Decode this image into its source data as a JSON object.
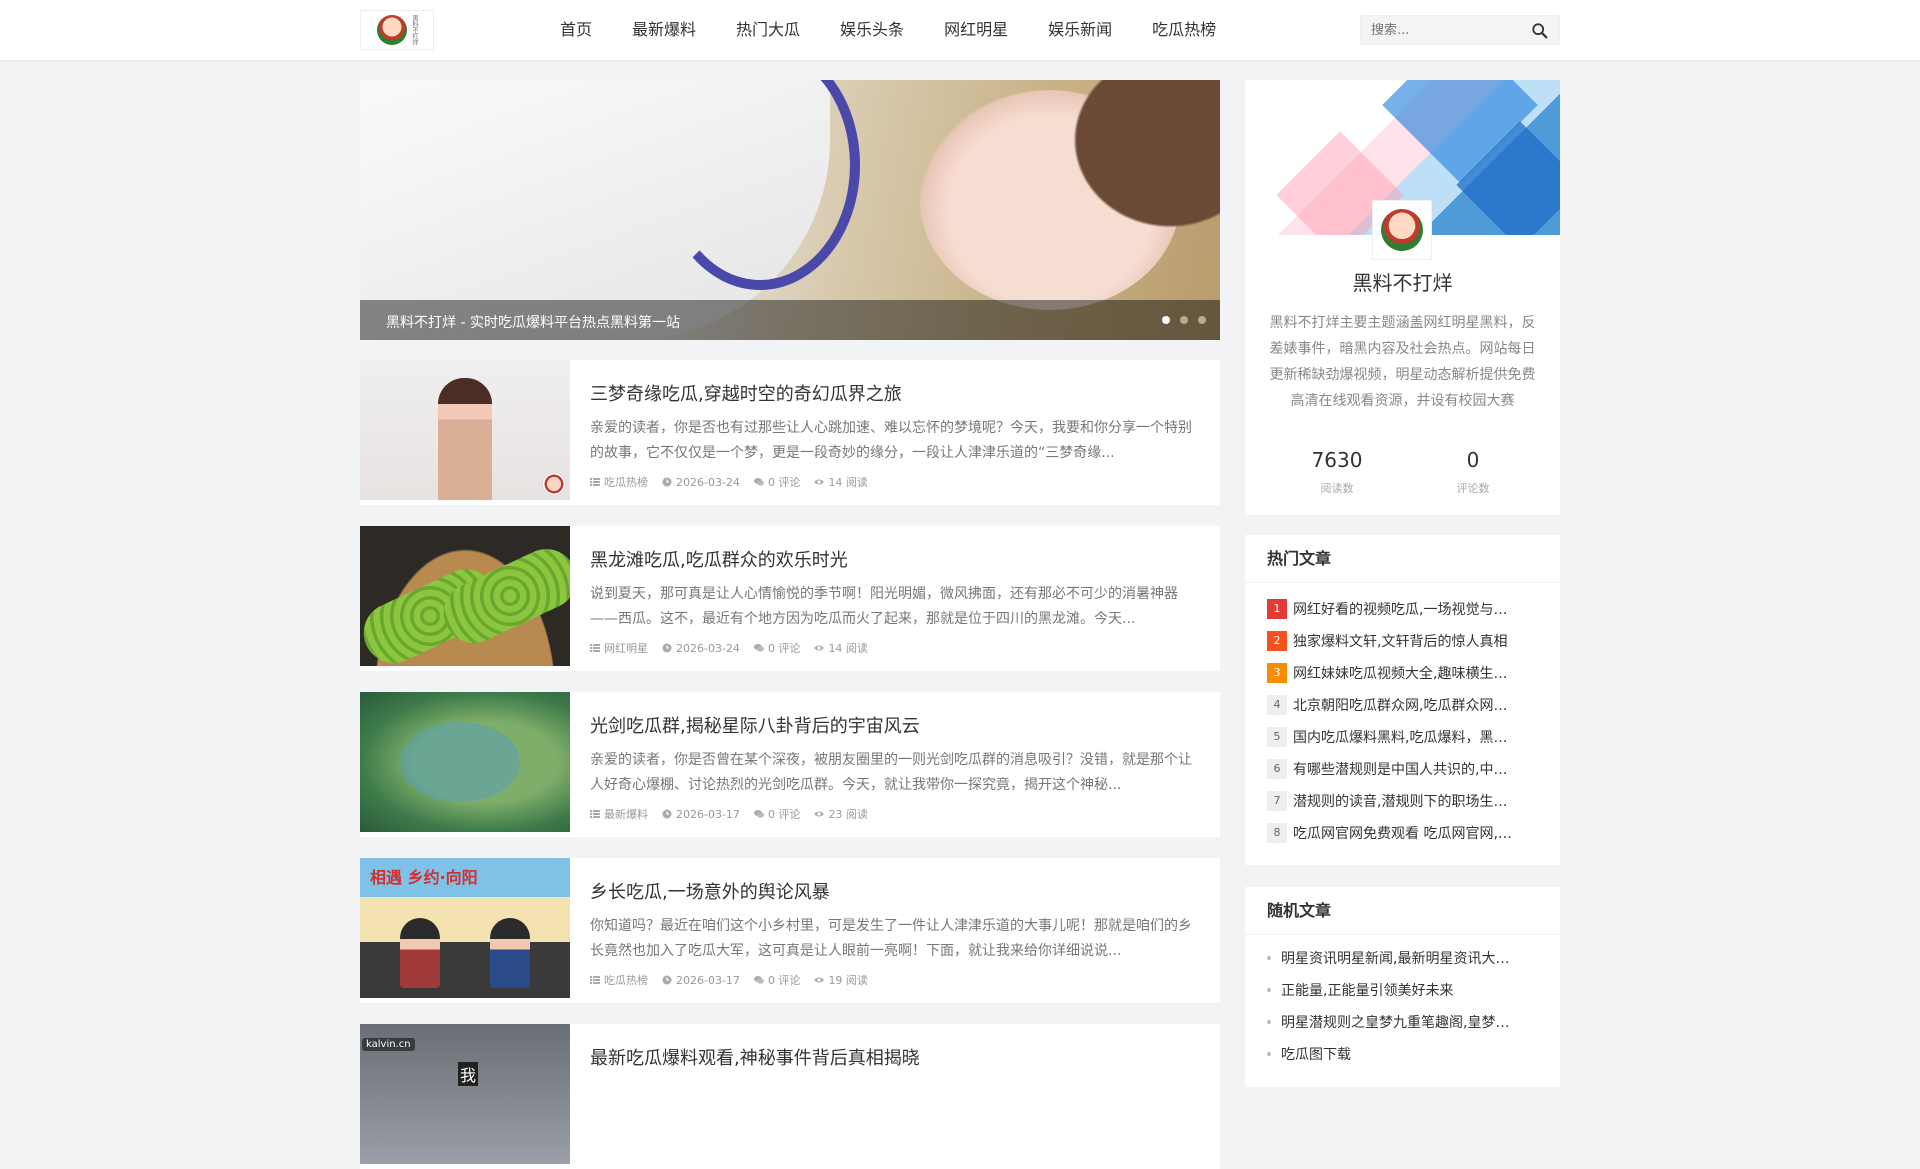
{
  "site": {
    "logo_text": "黑料不打烊"
  },
  "nav": {
    "items": [
      "首页",
      "最新爆料",
      "热门大瓜",
      "娱乐头条",
      "网红明星",
      "娱乐新闻",
      "吃瓜热榜"
    ]
  },
  "search": {
    "placeholder": "搜索..."
  },
  "slider": {
    "caption": "黑料不打烊 - 实时吃瓜爆料平台热点黑料第一站",
    "slide_count": 3,
    "active_index": 0
  },
  "articles": [
    {
      "title": "三梦奇缘吃瓜,穿越时空的奇幻瓜界之旅",
      "excerpt": "亲爱的读者，你是否也有过那些让人心跳加速、难以忘怀的梦境呢？今天，我要和你分享一个特别的故事，它不仅仅是一个梦，更是一段奇妙的缘分，一段让人津津乐道的“三梦奇缘...",
      "category": "吃瓜热榜",
      "date": "2026-03-24",
      "comments": "0 评论",
      "views": "14 阅读"
    },
    {
      "title": "黑龙滩吃瓜,吃瓜群众的欢乐时光",
      "excerpt": "说到夏天，那可真是让人心情愉悦的季节啊！阳光明媚，微风拂面，还有那必不可少的消暑神器——西瓜。这不，最近有个地方因为吃瓜而火了起来，那就是位于四川的黑龙滩。今天...",
      "category": "网红明星",
      "date": "2026-03-24",
      "comments": "0 评论",
      "views": "14 阅读"
    },
    {
      "title": "光剑吃瓜群,揭秘星际八卦背后的宇宙风云",
      "excerpt": "亲爱的读者，你是否曾在某个深夜，被朋友圈里的一则光剑吃瓜群的消息吸引？没错，就是那个让人好奇心爆棚、讨论热烈的光剑吃瓜群。今天，就让我带你一探究竟，揭开这个神秘...",
      "category": "最新爆料",
      "date": "2026-03-17",
      "comments": "0 评论",
      "views": "23 阅读"
    },
    {
      "title": "乡长吃瓜,一场意外的舆论风暴",
      "excerpt": "你知道吗？最近在咱们这个小乡村里，可是发生了一件让人津津乐道的大事儿呢！那就是咱们的乡长竟然也加入了吃瓜大军，这可真是让人眼前一亮啊！下面，就让我来给你详细说说...",
      "category": "吃瓜热榜",
      "date": "2026-03-17",
      "comments": "0 评论",
      "views": "19 阅读",
      "thumb_text": "相遇 乡约·向阳"
    },
    {
      "title": "最新吃瓜爆料观看,神秘事件背后真相揭晓",
      "excerpt": "",
      "category": "",
      "date": "",
      "comments": "",
      "views": "",
      "thumb_watermark": "kalvin.cn",
      "thumb_char": "我"
    }
  ],
  "profile": {
    "name": "黑料不打烊",
    "description": "黑料不打烊主要主题涵盖网红明星黑料，反差婊事件，暗黑内容及社会热点。网站每日更新稀缺劲爆视频，明星动态解析提供免费高清在线观看资源，并设有校园大赛",
    "stats": [
      {
        "value": "7630",
        "label": "阅读数"
      },
      {
        "value": "0",
        "label": "评论数"
      }
    ]
  },
  "hot_articles": {
    "title": "热门文章",
    "items": [
      "网红好看的视频吃瓜,一场视觉与…",
      "独家爆料文轩,文轩背后的惊人真相",
      "网红妹妹吃瓜视频大全,趣味横生…",
      "北京朝阳吃瓜群众网,吃瓜群众网…",
      "国内吃瓜爆料黑料,吃瓜爆料，黑…",
      "有哪些潜规则是中国人共识的,中…",
      "潜规则的读音,潜规则下的职场生…",
      "吃瓜网官网免费观看 吃瓜网官网,…"
    ]
  },
  "random_articles": {
    "title": "随机文章",
    "items": [
      "明星资讯明星新闻,最新明星资讯大…",
      "正能量,正能量引领美好未来",
      "明星潜规则之皇梦九重笔趣阁,皇梦…",
      "吃瓜图下载"
    ]
  },
  "colors": {
    "rank1": "#e53935",
    "rank2": "#f4511e",
    "rank3": "#fb8c00"
  }
}
